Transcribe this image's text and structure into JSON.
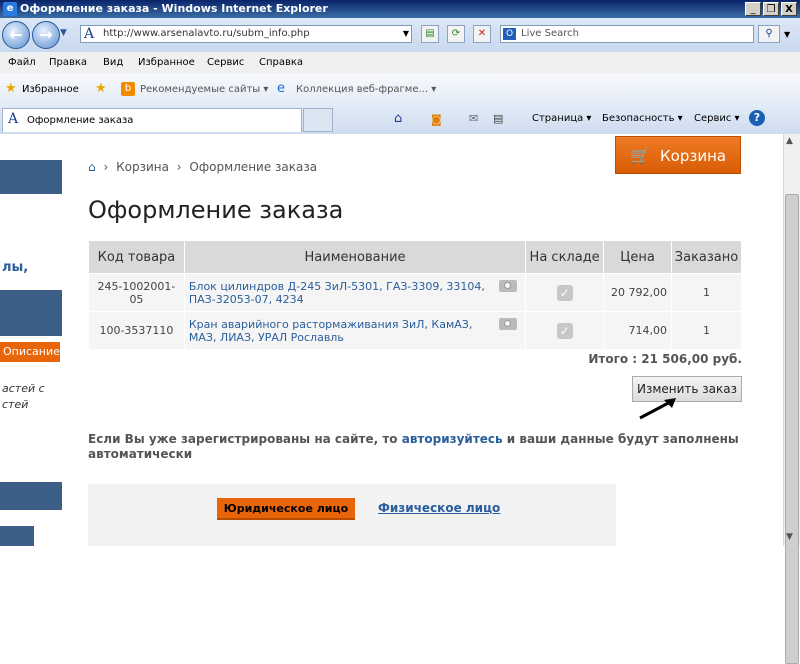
{
  "window": {
    "title": "Оформление заказа - Windows Internet Explorer",
    "app_icon": "ie-icon",
    "controls": [
      "_",
      "❐",
      "X"
    ]
  },
  "addressbar": {
    "url": "http://www.arsenalavto.ru/subm_info.php",
    "search_placeholder": "Live Search"
  },
  "menu": [
    "Файл",
    "Правка",
    "Вид",
    "Избранное",
    "Сервис",
    "Справка"
  ],
  "favorites": {
    "label": "Избранное",
    "items": [
      "Рекомендуемые сайты ▾",
      "Коллекция веб-фрагме... ▾"
    ]
  },
  "tabbar": {
    "tab_label": "Оформление заказа",
    "commands": [
      "Страница ▾",
      "Безопасность ▾",
      "Сервис ▾"
    ]
  },
  "sidebar": {
    "text_1": "лы,",
    "orange_label": "Описание",
    "italic_1": "астей с",
    "italic_2": "стей"
  },
  "cart_button": "Корзина",
  "breadcrumb": {
    "home_icon": "home-icon",
    "sep": "›",
    "items": [
      "Корзина",
      "Оформление заказа"
    ]
  },
  "page_title": "Оформление заказа",
  "table": {
    "headers": [
      "Код товара",
      "Наименование",
      "На складе",
      "Цена",
      "Заказано"
    ],
    "rows": [
      {
        "code": "245-1002001-05",
        "name": "Блок цилиндров Д-245 ЗиЛ-5301, ГАЗ-3309, 33104, ПАЗ-32053-07, 4234",
        "in_stock": true,
        "price": "20 792,00",
        "qty": "1"
      },
      {
        "code": "100-3537110",
        "name": "Кран аварийного растормаживания ЗиЛ, КамАЗ, МАЗ, ЛИАЗ, УРАЛ Рославль",
        "in_stock": true,
        "price": "714,00",
        "qty": "1"
      }
    ]
  },
  "total": "Итого : 21 506,00 руб.",
  "change_order_button": "Изменить заказ",
  "notice": {
    "before": "Если Вы уже зарегистрированы на сайте, то ",
    "link": "авторизуйтесь",
    "after": " и ваши данные будут заполнены автоматически"
  },
  "form_tabs": {
    "legal": "Юридическое лицо",
    "physical": "Физическое лицо"
  },
  "colors": {
    "accent_orange": "#e8650a",
    "link_blue": "#2a5e9c",
    "sidebar_blue": "#3b5f86"
  }
}
